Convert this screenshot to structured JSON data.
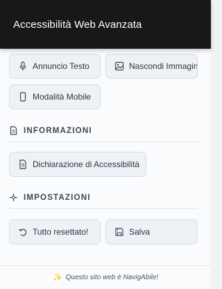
{
  "header": {
    "title": "Accessibilità Web Avanzata"
  },
  "actions": {
    "announce_text": "Annuncio Testo",
    "hide_images": "Nascondi Immagini",
    "mobile_mode": "Modalità Mobile"
  },
  "info_section": {
    "title": "INFORMAZIONI",
    "statement_label": "Dichiarazione di Accessibilità"
  },
  "settings_section": {
    "title": "IMPOSTAZIONI",
    "reset_label": "Tutto resettato!",
    "save_label": "Salva"
  },
  "footer": {
    "text": "Questo sito web è NavigAbile!"
  }
}
